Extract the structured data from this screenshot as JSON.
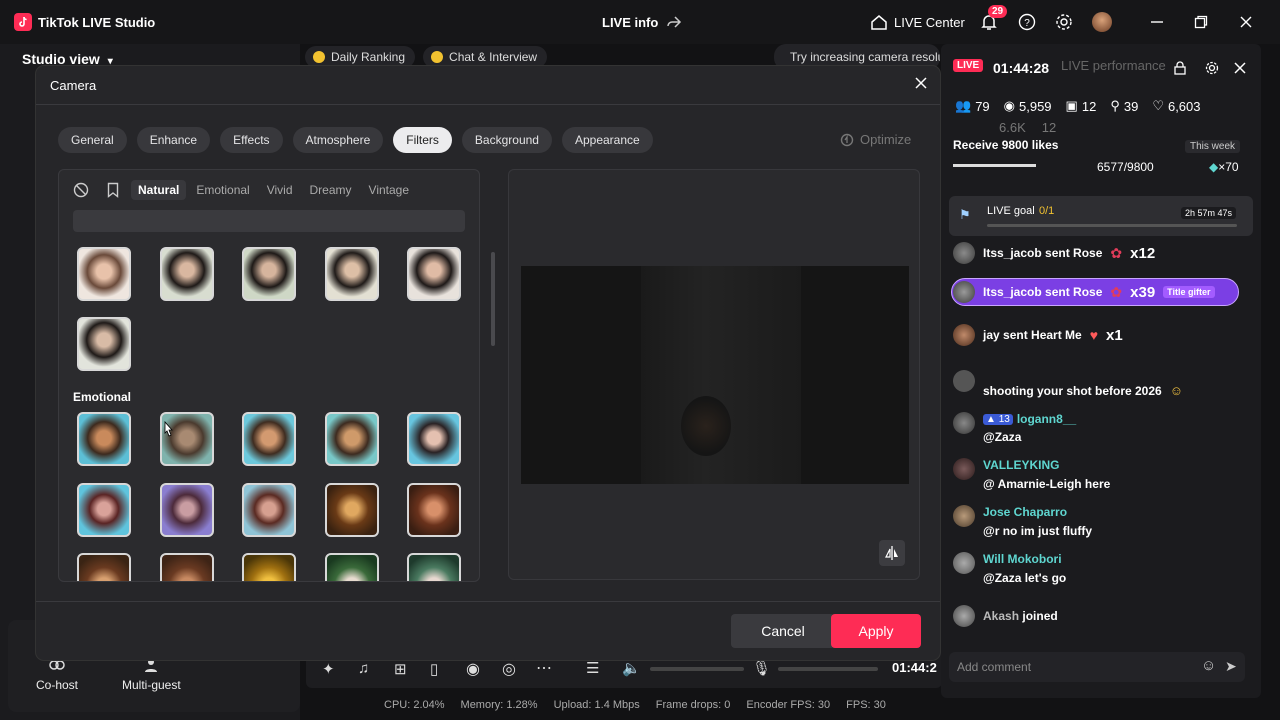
{
  "app": {
    "title": "TikTok LIVE Studio",
    "live_info": "LIVE info",
    "live_center": "LIVE Center",
    "notification_count": "29"
  },
  "studio": {
    "view_label": "Studio view",
    "pills": [
      "Daily Ranking",
      "Chat & Interview"
    ],
    "tip": "Try increasing camera resolution",
    "cohost": "Co-host",
    "multiguest": "Multi-guest",
    "stream_time": "01:44:2"
  },
  "status": {
    "cpu": "CPU: 2.04%",
    "memory": "Memory: 1.28%",
    "upload": "Upload: 1.4 Mbps",
    "frame_drops": "Frame drops: 0",
    "encoder_fps": "Encoder FPS: 30",
    "fps": "FPS: 30"
  },
  "modal": {
    "title": "Camera",
    "tabs": [
      "General",
      "Enhance",
      "Effects",
      "Atmosphere",
      "Filters",
      "Background",
      "Appearance"
    ],
    "active_tab": "Filters",
    "optimize": "Optimize",
    "filter_categories": [
      "Natural",
      "Emotional",
      "Vivid",
      "Dreamy",
      "Vintage"
    ],
    "active_category": "Natural",
    "section_emotional": "Emotional",
    "cancel": "Cancel",
    "apply": "Apply"
  },
  "right_panel": {
    "live_badge": "LIVE",
    "timer": "01:44:28",
    "ghost_title": "LIVE performance",
    "stats": {
      "viewers": "79",
      "views": "5,959",
      "gifts": "12",
      "new_followers": "39",
      "likes": "6,603"
    },
    "stats_row2": {
      "likes": "6.6K",
      "gifts": "12"
    },
    "receive_label": "Receive 9800 likes",
    "this_week": "This week",
    "likes_progress_text": "6577/9800",
    "likes_progress_fraction": 0.67,
    "reward": "×70",
    "goal": {
      "label": "LIVE goal",
      "value": "0/1",
      "timer": "2h 57m 47s"
    },
    "messages": [
      {
        "user": "Itss_jacob",
        "text": "sent Rose",
        "count": "x12"
      },
      {
        "user": "Itss_jacob",
        "text": "sent Rose",
        "count": "x39",
        "badge": "Title gifter"
      },
      {
        "user": "jay",
        "text": "sent Heart Me",
        "count": "x1"
      },
      {
        "user": "",
        "text": "shooting your shot before 2026"
      },
      {
        "user": "logann8__",
        "level": "13",
        "text": "@Zaza"
      },
      {
        "user": "VALLEYKING",
        "text": "@ Amarnie-Leigh here"
      },
      {
        "user": "Jose Chaparro",
        "text": "@r no im just fluffy"
      },
      {
        "user": "Will Mokobori",
        "text": "@Zaza let's go"
      },
      {
        "user": "Akash",
        "text": "joined"
      }
    ],
    "input_placeholder": "Add comment"
  },
  "colors": {
    "accent": "#fe2c55",
    "highlight": "#7b3fe4",
    "username_teal": "#5fd6d0"
  }
}
